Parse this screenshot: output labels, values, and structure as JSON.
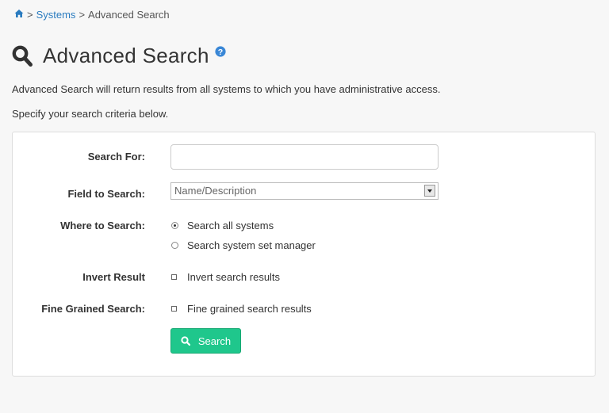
{
  "breadcrumb": {
    "home_icon": "home-icon",
    "separator": ">",
    "systems": "Systems",
    "current": "Advanced Search"
  },
  "header": {
    "title": "Advanced Search",
    "title_icon": "search-icon",
    "help_icon": "help-icon"
  },
  "description": {
    "line1": "Advanced Search will return results from all systems to which you have administrative access.",
    "line2": "Specify your search criteria below."
  },
  "form": {
    "search_for_label": "Search For:",
    "search_for_value": "",
    "field_label": "Field to Search:",
    "field_selected": "Name/Description",
    "where_label": "Where to Search:",
    "where_options": [
      {
        "label": "Search all systems",
        "checked": true
      },
      {
        "label": "Search system set manager",
        "checked": false
      }
    ],
    "invert_label": "Invert Result",
    "invert_option": "Invert search results",
    "fine_label": "Fine Grained Search:",
    "fine_option": "Fine grained search results",
    "search_button": "Search"
  },
  "colors": {
    "link": "#2a7bbf",
    "button": "#1fc78c",
    "help": "#3a87d6"
  }
}
